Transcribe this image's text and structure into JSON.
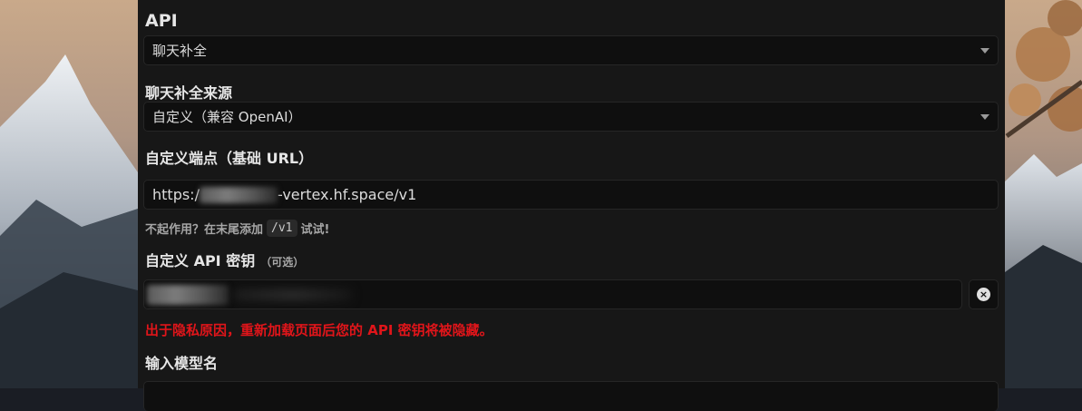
{
  "api": {
    "label": "API",
    "selected": "聊天补全"
  },
  "source": {
    "label": "聊天补全来源",
    "selected": "自定义（兼容 OpenAI）"
  },
  "endpoint": {
    "label": "自定义端点（基础 URL）",
    "value_prefix": "https:/",
    "value_suffix": "-vertex.hf.space/v1",
    "hint_before": "不起作用？在末尾添加",
    "hint_code": "/v1",
    "hint_after": "试试!"
  },
  "api_key": {
    "label": "自定义 API 密钥",
    "optional": "（可选）",
    "clear_icon": "×",
    "warning": "出于隐私原因，重新加载页面后您的 API 密钥将被隐藏。"
  },
  "model": {
    "label": "输入模型名"
  },
  "colors": {
    "panel": "#171717",
    "input_bg": "#0f0f0f",
    "warning": "#e0151a"
  }
}
